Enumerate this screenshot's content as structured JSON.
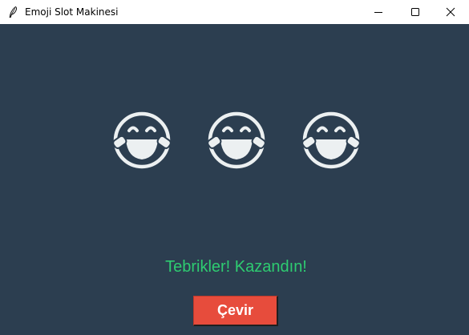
{
  "window": {
    "title": "Emoji Slot Makinesi",
    "app_icon": "feather-icon",
    "controls": {
      "minimize_icon": "minimize-icon",
      "maximize_icon": "maximize-icon",
      "close_icon": "close-icon"
    }
  },
  "reels": [
    {
      "emoji": "face-with-tears-of-joy-icon"
    },
    {
      "emoji": "face-with-tears-of-joy-icon"
    },
    {
      "emoji": "face-with-tears-of-joy-icon"
    }
  ],
  "result": {
    "message": "Tebrikler! Kazandın!",
    "color": "#2ecc71"
  },
  "spin_button": {
    "label": "Çevir",
    "color": "#e74c3c"
  },
  "theme": {
    "background": "#2c3e50",
    "emoji_color": "#ecf0f1"
  }
}
